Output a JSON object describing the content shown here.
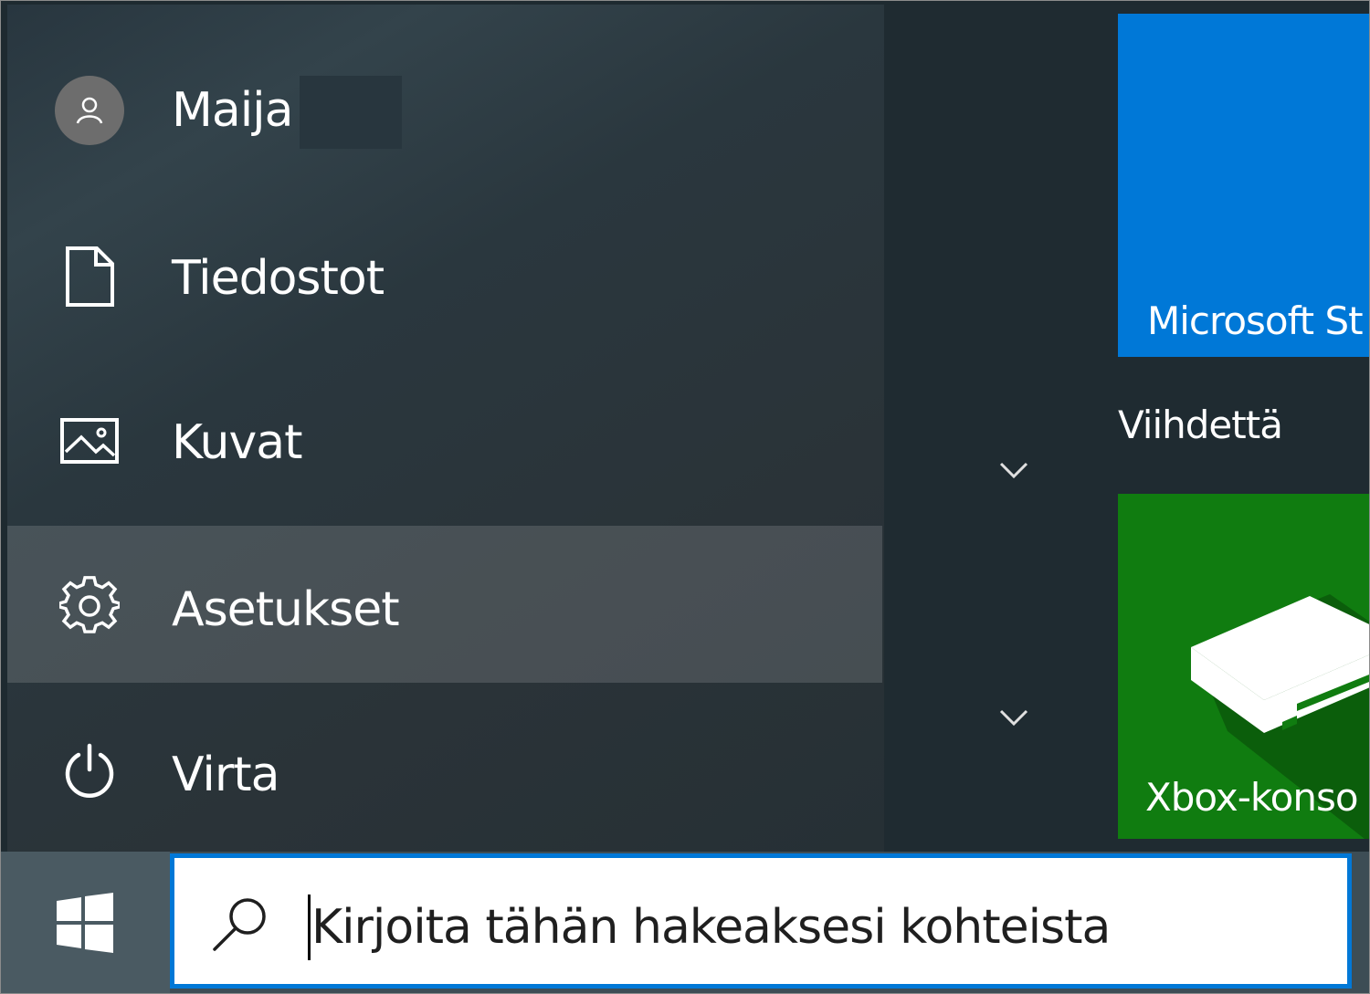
{
  "start_menu": {
    "user": {
      "name": "Maija",
      "icon": "person-icon"
    },
    "nav_items": [
      {
        "label": "Tiedostot",
        "icon": "document-icon"
      },
      {
        "label": "Kuvat",
        "icon": "pictures-icon"
      },
      {
        "label": "Asetukset",
        "icon": "gear-icon",
        "selected": true
      },
      {
        "label": "Virta",
        "icon": "power-icon"
      }
    ],
    "chevrons": [
      "chevron-down-icon",
      "chevron-down-icon"
    ]
  },
  "tiles": {
    "store": {
      "label": "Microsoft St",
      "color": "#0078d7"
    },
    "group_label": "Viihdettä",
    "xbox": {
      "label": "Xbox-konso",
      "color": "#107c10"
    }
  },
  "taskbar": {
    "start_icon": "windows-logo-icon",
    "search": {
      "icon": "search-icon",
      "placeholder": "Kirjoita tähän hakeaksesi kohteista",
      "border_color": "#0078d7"
    }
  }
}
